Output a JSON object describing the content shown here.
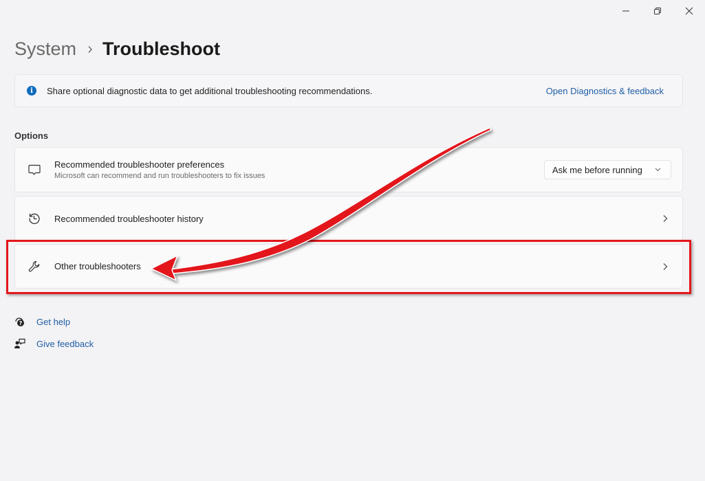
{
  "window": {
    "controls": [
      "minimize",
      "restore",
      "close"
    ]
  },
  "breadcrumb": {
    "parent": "System",
    "separator": "›",
    "current": "Troubleshoot"
  },
  "info_bar": {
    "icon": "info-icon",
    "icon_glyph": "i",
    "text": "Share optional diagnostic data to get additional troubleshooting recommendations.",
    "link": "Open Diagnostics & feedback"
  },
  "options": {
    "label": "Options",
    "items": [
      {
        "icon": "chat-bubble-icon",
        "title": "Recommended troubleshooter preferences",
        "subtitle": "Microsoft can recommend and run troubleshooters to fix issues",
        "control": "dropdown",
        "dropdown_value": "Ask me before running"
      },
      {
        "icon": "history-icon",
        "title": "Recommended troubleshooter history",
        "control": "chevron"
      },
      {
        "icon": "wrench-icon",
        "title": "Other troubleshooters",
        "control": "chevron",
        "highlighted": true
      }
    ]
  },
  "help_links": [
    {
      "icon": "get-help-icon",
      "label": "Get help"
    },
    {
      "icon": "give-feedback-icon",
      "label": "Give feedback"
    }
  ],
  "annotation": {
    "type": "arrow",
    "color": "#e3161b",
    "target": "Other troubleshooters"
  }
}
